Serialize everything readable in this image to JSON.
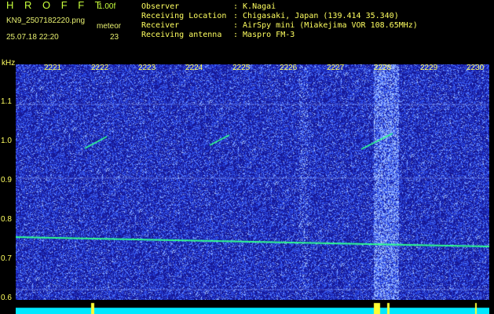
{
  "header": {
    "app_title": "H R O F F T",
    "version": "1.00f",
    "filename": "KN9_2507182220.png",
    "mode": "meteor",
    "timestamp": "25.07.18 22:20",
    "count": "23",
    "info": [
      {
        "key": "Observer",
        "value": ": K.Nagai"
      },
      {
        "key": "Receiving Location",
        "value": ": Chigasaki, Japan (139.414 35.340)"
      },
      {
        "key": "Receiver",
        "value": ": AirSpy mini (Miakejima VOR 108.65MHz)"
      },
      {
        "key": "Receiving antenna",
        "value": ": Maspro FM-3"
      }
    ]
  },
  "spectrogram": {
    "y_unit": "kHz",
    "x_ticks": [
      "2221",
      "2222",
      "2223",
      "2224",
      "2225",
      "2226",
      "2227",
      "2228",
      "2229",
      "2230"
    ],
    "y_ticks": [
      "1.1",
      "1.0",
      "0.9",
      "0.8",
      "0.7",
      "0.6"
    ],
    "colors": {
      "background": "#1a1aa0",
      "noise_light": "#3a5aff",
      "signal": "#30ff90",
      "grid_line": "#9ab0ff",
      "level_bar": "#00e8ff",
      "level_peak": "#ffff30",
      "label": "#ffff60"
    }
  }
}
